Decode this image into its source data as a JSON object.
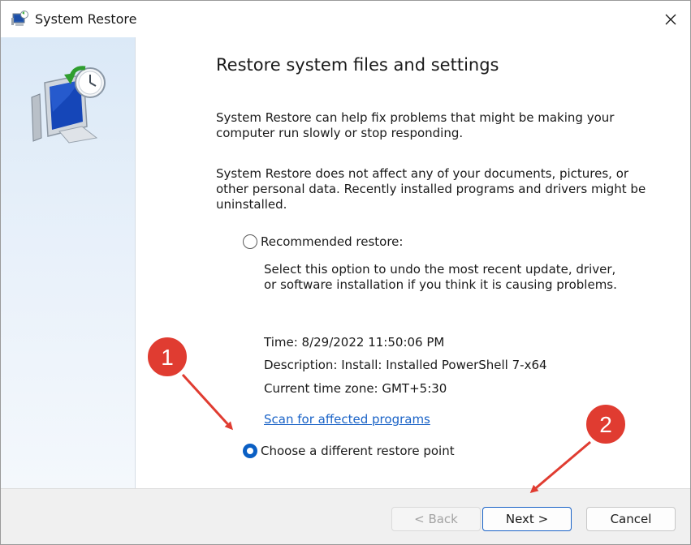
{
  "window": {
    "title": "System Restore",
    "close_glyph": "✕"
  },
  "content": {
    "heading": "Restore system files and settings",
    "para1": "System Restore can help fix problems that might be making your computer run slowly or stop responding.",
    "para2": "System Restore does not affect any of your documents, pictures, or other personal data. Recently installed programs and drivers might be uninstalled.",
    "recommended": {
      "label": "Recommended restore:",
      "checked": false,
      "description_line1": "Select this option to undo the most recent update, driver,",
      "description_line2": "or software installation if you think it is causing problems."
    },
    "details": {
      "time": "Time: 8/29/2022 11:50:06 PM",
      "description": "Description: Install: Installed PowerShell 7-x64",
      "timezone": "Current time zone: GMT+5:30"
    },
    "scan_link": "Scan for affected programs",
    "different": {
      "label": "Choose a different restore point",
      "checked": true
    }
  },
  "footer": {
    "back": "< Back",
    "next": "Next >",
    "cancel": "Cancel"
  },
  "annotations": {
    "badge1": "1",
    "badge2": "2",
    "color": "#e03c31"
  },
  "colors": {
    "accent": "#0a5fc4",
    "link": "#1a63c7"
  },
  "icons": {
    "title": "system-restore-icon",
    "sidebar": "system-restore-illustration"
  }
}
